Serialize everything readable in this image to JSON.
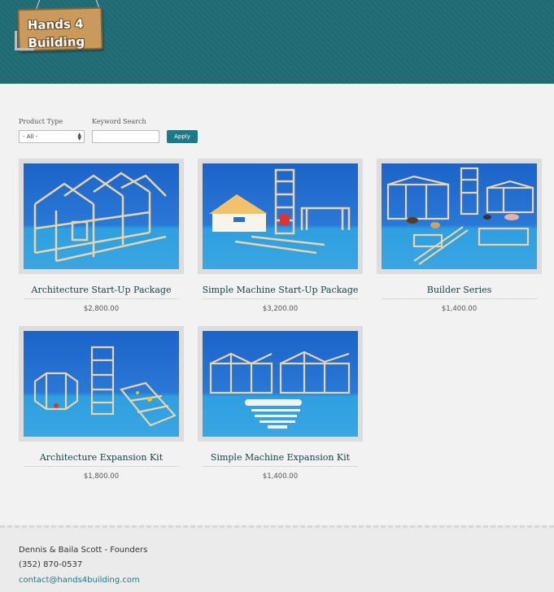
{
  "brand": {
    "logo_text": "Hands 4 Building"
  },
  "filters": {
    "product_type_label": "Product Type",
    "product_type_value": "- All -",
    "keyword_label": "Keyword Search",
    "keyword_value": "",
    "apply_label": "Apply"
  },
  "products": [
    {
      "title": "Architecture Start-Up Package",
      "price": "$2,800.00"
    },
    {
      "title": "Simple Machine Start-Up Package",
      "price": "$3,200.00"
    },
    {
      "title": "Builder Series",
      "price": "$1,400.00"
    },
    {
      "title": "Architecture Expansion Kit",
      "price": "$1,800.00"
    },
    {
      "title": "Simple Machine Expansion Kit",
      "price": "$1,400.00"
    }
  ],
  "footer": {
    "founders": "Dennis & Baila Scott - Founders",
    "phone": "(352) 870-0537",
    "email": "contact@hands4building.com"
  },
  "colors": {
    "header": "#1e6b74",
    "accent": "#1b7988",
    "title": "#16444b"
  }
}
